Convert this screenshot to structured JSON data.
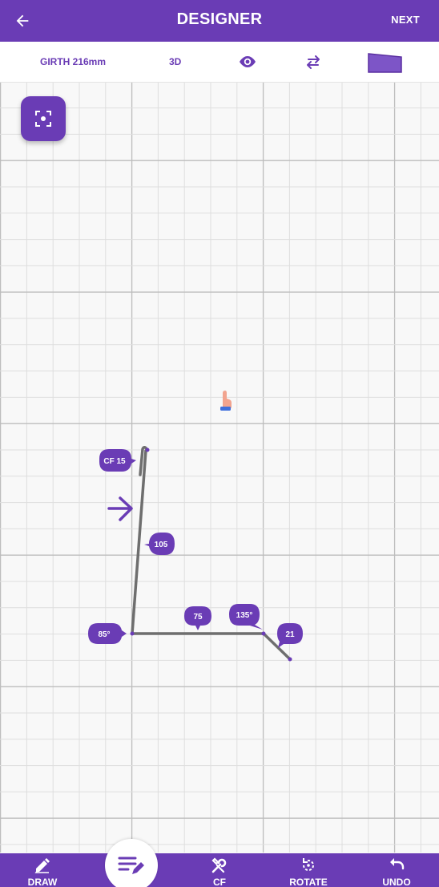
{
  "header": {
    "title": "DESIGNER",
    "next_label": "NEXT"
  },
  "toolbar": {
    "girth_label": "GIRTH 216mm",
    "view3d_label": "3D"
  },
  "labels": {
    "cf": "CF 15",
    "len1": "105",
    "len2": "75",
    "len3": "21",
    "angle1": "85°",
    "angle2": "135°"
  },
  "bottom_nav": {
    "draw": "DRAW",
    "cf": "CF",
    "rotate": "ROTATE",
    "undo": "UNDO"
  },
  "colors": {
    "accent": "#6a3cb5",
    "line": "#6e6e6e",
    "grid_minor": "#dedede",
    "grid_major": "#bdbdbd"
  }
}
